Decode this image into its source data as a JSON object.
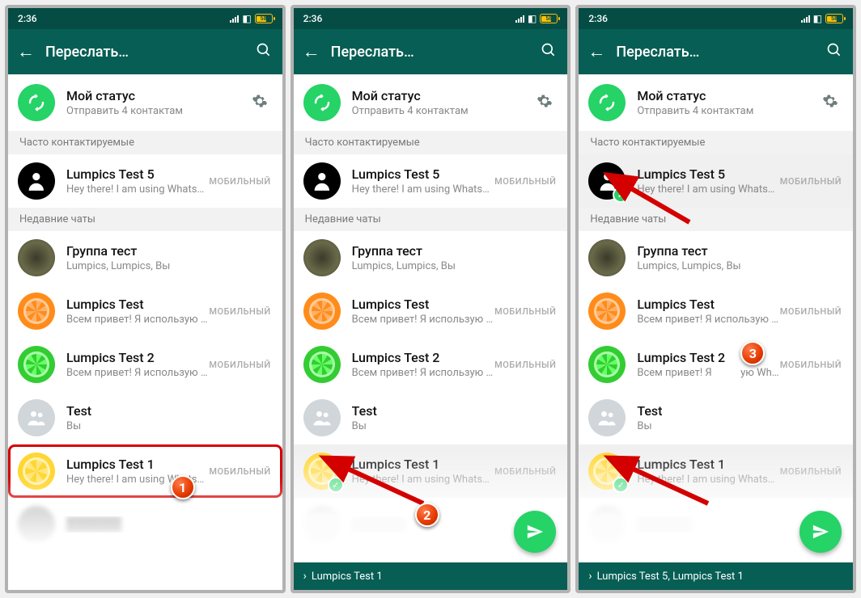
{
  "statusbar": {
    "time": "2:36",
    "battery_text": "58"
  },
  "appbar": {
    "title": "Переслать…"
  },
  "mystatus": {
    "title": "Мой статус",
    "subtitle": "Отправить 4 контактам"
  },
  "sections": {
    "frequent": "Часто контактируемые",
    "recent": "Недавние чаты"
  },
  "tag_mobile": "МОБИЛЬНЫЙ",
  "contacts": {
    "test5": {
      "name": "Lumpics Test 5",
      "sub": "Hey there! I am using WhatsApp."
    },
    "group": {
      "name": "Группа тест",
      "sub": "Lumpics, Lumpics, Вы"
    },
    "lumpics": {
      "name": "Lumpics Test",
      "sub": "Всем привет! Я использую WhatsApp."
    },
    "lumpics2": {
      "name": "Lumpics Test 2",
      "sub": "Всем привет! Я использую WhatsApp."
    },
    "lumpics2_trunc": {
      "name": "Lumpics Test 2",
      "sub": "Всем привет! Я           ую WhatsApp."
    },
    "test": {
      "name": "Test",
      "sub": "Вы"
    },
    "test1": {
      "name": "Lumpics Test 1",
      "sub": "Hey there! I am using WhatsApp."
    }
  },
  "selection_bars": {
    "screen2": "Lumpics Test 1",
    "screen3": "Lumpics Test 5, Lumpics Test 1"
  },
  "badges": {
    "b1": "1",
    "b2": "2",
    "b3": "3"
  }
}
